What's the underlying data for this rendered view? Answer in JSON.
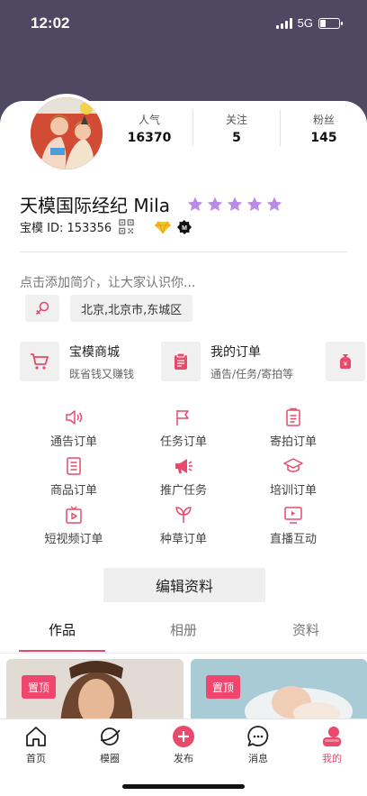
{
  "status_bar": {
    "time": "12:02",
    "network": "5G",
    "battery_level": 0.3
  },
  "profile": {
    "stats": [
      {
        "label": "人气",
        "value": "16370"
      },
      {
        "label": "关注",
        "value": "5"
      },
      {
        "label": "粉丝",
        "value": "145"
      }
    ],
    "name": "天模国际经纪 Mila",
    "rating_stars": 5,
    "model_id": "宝模 ID: 153356",
    "bio_placeholder": "点击添加简介，让大家认识你...",
    "location": "北京,北京市,东城区"
  },
  "shortcuts": [
    {
      "title": "宝模商城",
      "subtitle": "既省钱又赚钱",
      "icon": "cart-icon"
    },
    {
      "title": "我的订单",
      "subtitle": "通告/任务/寄拍等",
      "icon": "order-icon"
    }
  ],
  "menu": [
    {
      "label": "通告订单",
      "icon": "speaker-icon"
    },
    {
      "label": "任务订单",
      "icon": "flag-icon"
    },
    {
      "label": "寄拍订单",
      "icon": "clipboard-icon"
    },
    {
      "label": "商品订单",
      "icon": "document-icon"
    },
    {
      "label": "推广任务",
      "icon": "megaphone-icon"
    },
    {
      "label": "培训订单",
      "icon": "graduation-cap-icon"
    },
    {
      "label": "短视频订单",
      "icon": "video-icon"
    },
    {
      "label": "种草订单",
      "icon": "sprout-icon"
    },
    {
      "label": "直播互动",
      "icon": "live-tv-icon"
    }
  ],
  "edit_button": "编辑资料",
  "tabs": [
    {
      "label": "作品",
      "active": true
    },
    {
      "label": "相册",
      "active": false
    },
    {
      "label": "资料",
      "active": false
    }
  ],
  "gallery": [
    {
      "badge": "置顶"
    },
    {
      "badge": "置顶"
    }
  ],
  "bottom_nav": [
    {
      "label": "首页",
      "icon": "home-icon",
      "active": false
    },
    {
      "label": "模圈",
      "icon": "planet-icon",
      "active": false
    },
    {
      "label": "发布",
      "icon": "add-icon",
      "active": false
    },
    {
      "label": "消息",
      "icon": "chat-icon",
      "active": false
    },
    {
      "label": "我的",
      "icon": "profile-icon",
      "active": true
    }
  ],
  "colors": {
    "accent": "#e84a6c",
    "header": "#4e4863",
    "star": "#b98ae6"
  }
}
